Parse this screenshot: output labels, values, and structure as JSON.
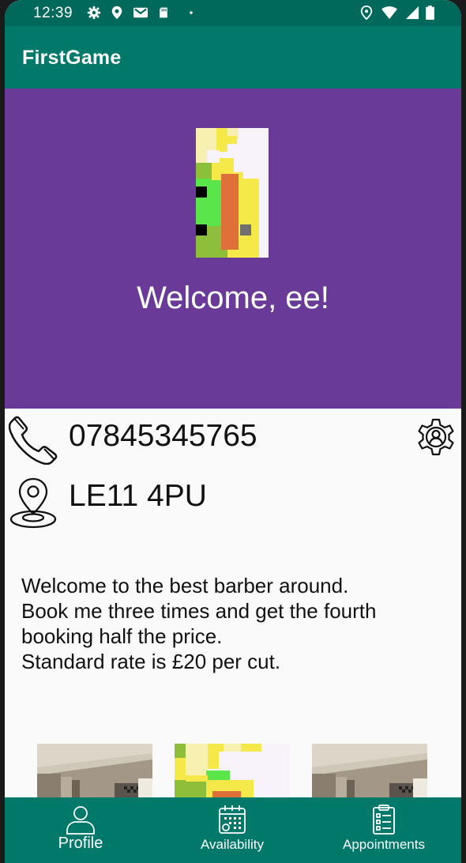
{
  "status_bar": {
    "time": "12:39",
    "left_icons": [
      "gear-icon",
      "location-pin-icon",
      "gmail-icon",
      "sd-card-icon",
      "dot-icon"
    ],
    "right_icons": [
      "location-pin-icon",
      "wifi-icon",
      "signal-icon",
      "battery-icon"
    ]
  },
  "app_bar": {
    "title": "FirstGame"
  },
  "header": {
    "avatar_icon": "pixel-art-avatar",
    "welcome_text": "Welcome, ee!",
    "background_color": "#6a3a98"
  },
  "contact": {
    "phone": "07845345765",
    "phone_icon": "phone-icon",
    "location": "LE11 4PU",
    "location_icon": "location-pin-icon",
    "settings_icon": "settings-gear-icon"
  },
  "description": {
    "lines": [
      "Welcome to the best barber around.",
      "Book me three times and get the fourth",
      "booking half the price.",
      "Standard rate is £20 per cut."
    ]
  },
  "gallery": {
    "items": [
      "room-photo",
      "pixel-art-avatar",
      "room-photo"
    ]
  },
  "bottom_nav": {
    "items": [
      {
        "label": "Profile",
        "icon": "person-icon"
      },
      {
        "label": "Availability",
        "icon": "calendar-icon"
      },
      {
        "label": "Appointments",
        "icon": "clipboard-icon"
      }
    ]
  },
  "colors": {
    "primary_dark": "#00695c",
    "primary": "#00796b",
    "header_purple": "#6a3a98"
  }
}
